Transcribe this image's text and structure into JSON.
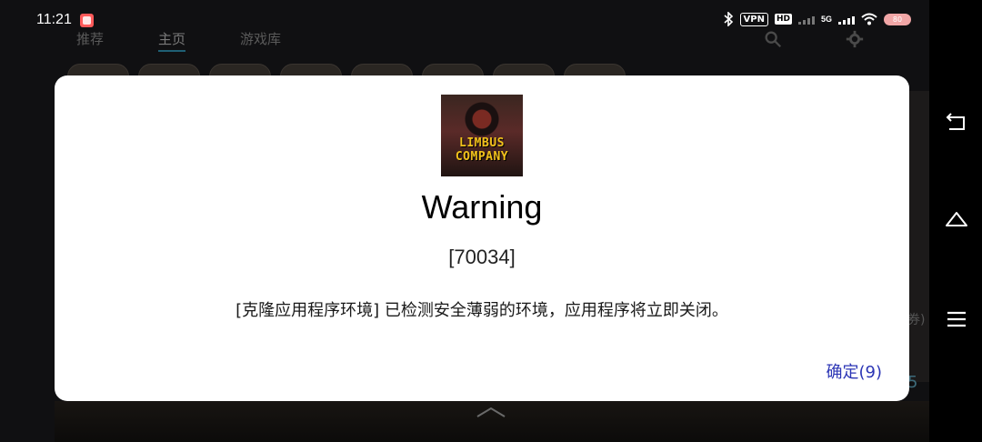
{
  "status_bar": {
    "time": "11:21",
    "vpn_label": "VPN",
    "hd_label": "HD",
    "network_label": "5G",
    "battery_level": "80"
  },
  "background_app": {
    "tabs": [
      {
        "label": "推荐"
      },
      {
        "label": "主页"
      },
      {
        "label": "游戏库"
      }
    ],
    "right_text": "券)",
    "right_number": "5"
  },
  "dialog": {
    "icon_logo_line1": "LIMBUS",
    "icon_logo_line2": "COMPANY",
    "title": "Warning",
    "code": "[70034]",
    "message": "[克隆应用程序环境] 已检测安全薄弱的环境，应用程序将立即关闭。",
    "ok_label": "确定(9)"
  },
  "icons": {
    "back": "back-icon",
    "home": "home-icon",
    "menu": "menu-icon",
    "search": "search-icon",
    "settings": "gear-icon"
  },
  "colors": {
    "dialog_bg": "#ffffff",
    "button_text": "#2b35b5",
    "scrim": "#0d0d0f"
  }
}
